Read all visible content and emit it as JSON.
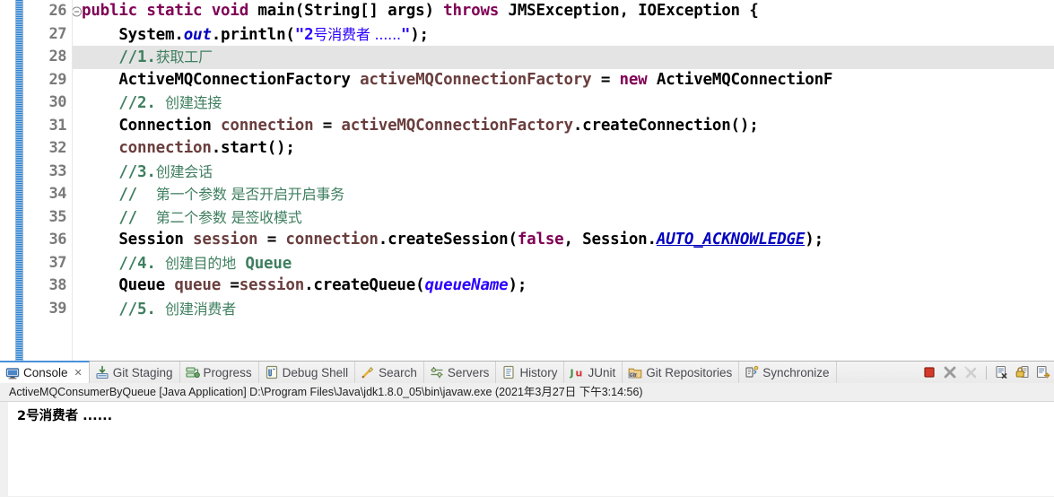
{
  "editor": {
    "first_line_number": 26,
    "highlighted_line": 28,
    "lines": [
      {
        "num": "26",
        "fold": true,
        "text": "public static void main(String[] args) throws JMSException, IOException {"
      },
      {
        "num": "27",
        "fold": false,
        "text": "System.out.println(\"2号消费者 ......\");"
      },
      {
        "num": "28",
        "fold": false,
        "text": "//1.获取工厂"
      },
      {
        "num": "29",
        "fold": false,
        "text": "ActiveMQConnectionFactory activeMQConnectionFactory = new ActiveMQConnectionF"
      },
      {
        "num": "30",
        "fold": false,
        "text": "//2. 创建连接"
      },
      {
        "num": "31",
        "fold": false,
        "text": "Connection connection = activeMQConnectionFactory.createConnection();"
      },
      {
        "num": "32",
        "fold": false,
        "text": "connection.start();"
      },
      {
        "num": "33",
        "fold": false,
        "text": "//3.创建会话"
      },
      {
        "num": "34",
        "fold": false,
        "text": "//  第一个参数 是否开启开启事务"
      },
      {
        "num": "35",
        "fold": false,
        "text": "//  第二个参数 是签收模式"
      },
      {
        "num": "36",
        "fold": false,
        "text": "Session session = connection.createSession(false, Session.AUTO_ACKNOWLEDGE);"
      },
      {
        "num": "37",
        "fold": false,
        "text": "//4. 创建目的地 Queue"
      },
      {
        "num": "38",
        "fold": false,
        "text": "Queue queue =session.createQueue(queueName);"
      },
      {
        "num": "39",
        "fold": false,
        "text": "//5. 创建消费者"
      }
    ]
  },
  "bottom_panel": {
    "tabs": [
      {
        "label": "Console",
        "icon": "console-icon",
        "active": true,
        "closable": true
      },
      {
        "label": "Git Staging",
        "icon": "git-staging-icon",
        "active": false,
        "closable": false
      },
      {
        "label": "Progress",
        "icon": "progress-icon",
        "active": false,
        "closable": false
      },
      {
        "label": "Debug Shell",
        "icon": "debug-shell-icon",
        "active": false,
        "closable": false
      },
      {
        "label": "Search",
        "icon": "search-icon",
        "active": false,
        "closable": false
      },
      {
        "label": "Servers",
        "icon": "servers-icon",
        "active": false,
        "closable": false
      },
      {
        "label": "History",
        "icon": "history-icon",
        "active": false,
        "closable": false
      },
      {
        "label": "JUnit",
        "icon": "junit-icon",
        "active": false,
        "closable": false
      },
      {
        "label": "Git Repositories",
        "icon": "git-repositories-icon",
        "active": false,
        "closable": false
      },
      {
        "label": "Synchronize",
        "icon": "synchronize-icon",
        "active": false,
        "closable": false
      }
    ],
    "close_glyph": "✕",
    "toolbar": [
      {
        "name": "terminate-button",
        "icon": "stop-square-icon",
        "enabled": true
      },
      {
        "name": "remove-launch-button",
        "icon": "remove-x-icon",
        "enabled": true
      },
      {
        "name": "remove-all-launches-button",
        "icon": "remove-all-x-icon",
        "enabled": false
      },
      {
        "name": "clear-console-button",
        "icon": "clear-console-icon",
        "enabled": true
      },
      {
        "name": "scroll-lock-button",
        "icon": "lock-icon",
        "enabled": true
      },
      {
        "name": "pin-console-button",
        "icon": "pin-console-icon",
        "enabled": true
      }
    ],
    "console": {
      "header": "ActiveMQConsumerByQueue [Java Application] D:\\Program Files\\Java\\jdk1.8.0_05\\bin\\javaw.exe  (2021年3月27日 下午3:14:56)",
      "output": [
        "2号消费者 ......"
      ]
    }
  },
  "colors": {
    "keyword": "#7f0055",
    "string": "#2a00ff",
    "comment": "#3f7f5f",
    "field": "#0000c0",
    "identifier": "#6a3e3e",
    "line_number": "#7a7a7a",
    "highlight_row": "#e4e4e4",
    "diff_bar": "#2f7fd0",
    "active_tab_accent": "#4a90d9",
    "stop_red": "#d43a2a"
  }
}
